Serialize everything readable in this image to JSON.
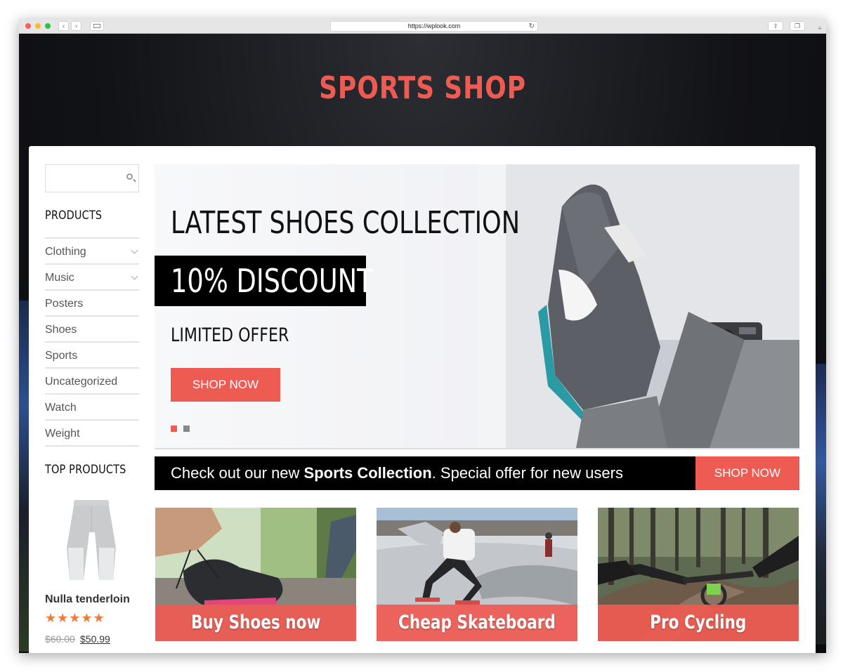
{
  "browser": {
    "url": "https://wplook.com"
  },
  "site": {
    "title": "SPORTS SHOP"
  },
  "sidebar": {
    "search_placeholder": "",
    "products_title": "PRODUCTS",
    "categories": [
      {
        "label": "Clothing",
        "has_children": true
      },
      {
        "label": "Music",
        "has_children": true
      },
      {
        "label": "Posters",
        "has_children": false
      },
      {
        "label": "Shoes",
        "has_children": false
      },
      {
        "label": "Sports",
        "has_children": false
      },
      {
        "label": "Uncategorized",
        "has_children": false
      },
      {
        "label": "Watch",
        "has_children": false
      },
      {
        "label": "Weight",
        "has_children": false
      }
    ],
    "top_products_title": "TOP PRODUCTS",
    "top_product": {
      "name": "Nulla tenderloin",
      "rating": 5,
      "stars": "★★★★★",
      "old_price": "$60.00",
      "new_price": "$50.99"
    }
  },
  "slider": {
    "title": "LATEST SHOES COLLECTION",
    "discount": "10% DISCOUNT",
    "offer": "LIMITED OFFER",
    "button": "SHOP NOW",
    "slide_count": 2,
    "active_slide": 1
  },
  "promo": {
    "text_before": "Check out our new ",
    "text_bold": "Sports Collection",
    "text_after": ". Special offer for new users",
    "button": "SHOP NOW"
  },
  "cards": [
    {
      "label": "Buy Shoes now"
    },
    {
      "label": "Cheap Skateboard"
    },
    {
      "label": "Pro Cycling"
    }
  ],
  "colors": {
    "accent": "#ee5b53",
    "dark": "#000000",
    "stars": "#ee7a3a"
  }
}
